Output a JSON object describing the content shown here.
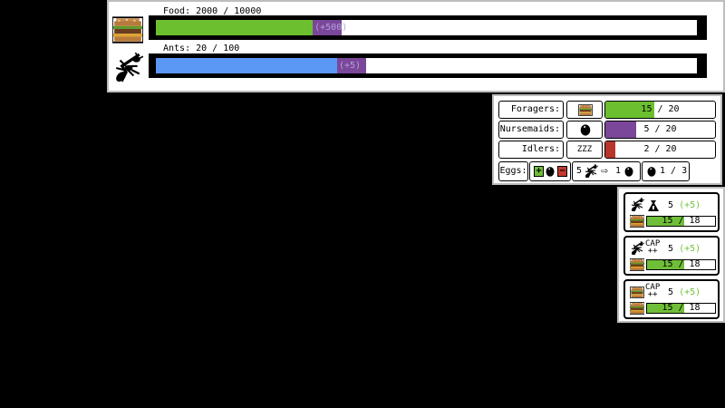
{
  "colors": {
    "food_fill": "#6cbf2f",
    "food_pending": "#7a479a",
    "ant_fill": "#5b97f4",
    "ant_pending": "#7a479a",
    "forager": "#6cbf2f",
    "nurse": "#7a479a",
    "idle": "#b8352a"
  },
  "resources": {
    "food": {
      "label": "Food: 2000 / 10000",
      "icon": "burger-icon",
      "fill": 0.29,
      "pending": 0.053,
      "pending_label": "(+500)"
    },
    "ants": {
      "label": "Ants: 20 / 100",
      "icon": "ant-icon",
      "fill": 0.335,
      "pending": 0.053,
      "pending_label": "(+5)"
    }
  },
  "jobs": [
    {
      "label": "Foragers:",
      "icon": "burger-icon",
      "value": "15 / 20",
      "fraction": 0.45,
      "color_key": "forager"
    },
    {
      "label": "Nursemaids:",
      "icon": "egg-icon",
      "value": "5 / 20",
      "fraction": 0.28,
      "color_key": "nurse"
    },
    {
      "label": "Idlers:",
      "icon": "zzz-icon",
      "icon_text": "ZZZ",
      "value": "2 / 20",
      "fraction": 0.09,
      "color_key": "idle"
    }
  ],
  "eggs": {
    "label": "Eggs:",
    "add": "+",
    "remove": "−",
    "conversion_count": "5",
    "conversion_result": "1",
    "egg_count": "1 / 3"
  },
  "cards": [
    {
      "icon": "ant-with-bag-icon",
      "count": "5",
      "delta": "(+5)",
      "cost": "15 / 18",
      "fraction": 0.55
    },
    {
      "icon": "ant-capacity-upgrade-icon",
      "cap": "CAP\n++",
      "count": "5",
      "delta": "(+5)",
      "cost": "15 / 18",
      "fraction": 0.55
    },
    {
      "icon": "burger-capacity-upgrade-icon",
      "cap": "CAP\n++",
      "count": "5",
      "delta": "(+5)",
      "cost": "15 / 18",
      "fraction": 0.55
    }
  ]
}
